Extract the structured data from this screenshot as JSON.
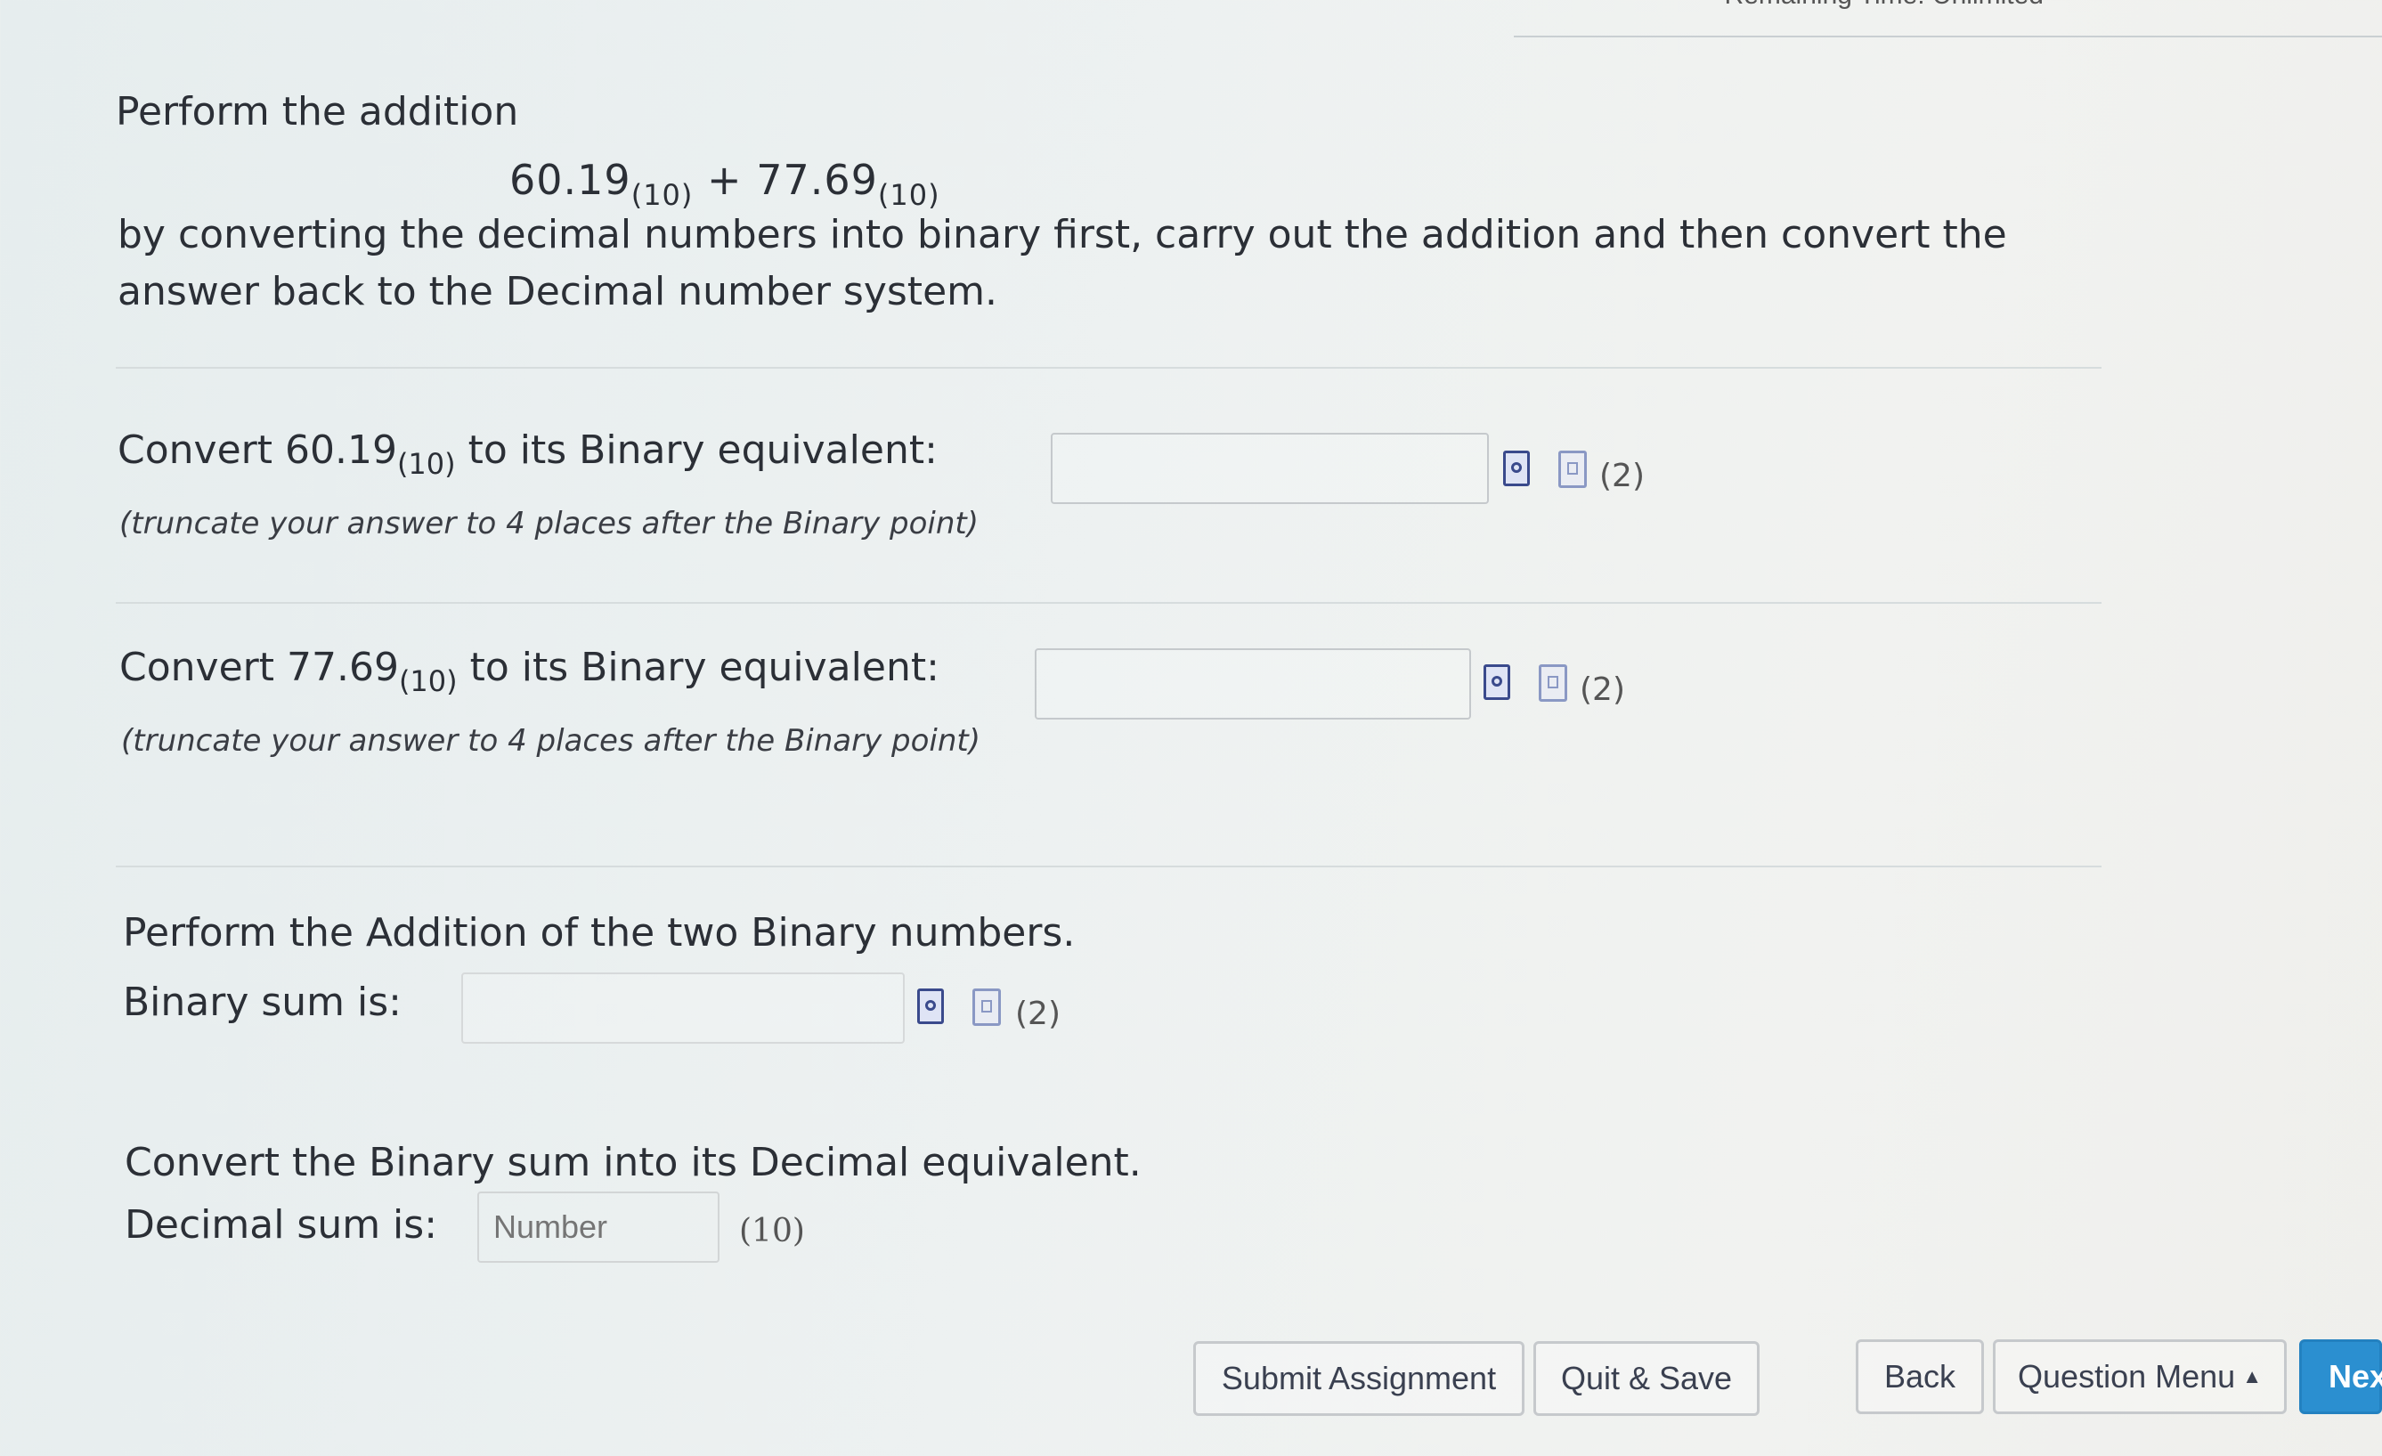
{
  "header": {
    "timer_text": "Remaining Time: Unlimited"
  },
  "problem": {
    "title": "Perform the addition",
    "expr_a": "60.19",
    "expr_a_base": "(10)",
    "expr_op": " + ",
    "expr_b": "77.69",
    "expr_b_base": "(10)",
    "description": "by converting the decimal numbers into binary first, carry out the addition and then convert the answer back to the Decimal number system."
  },
  "q1": {
    "prefix": "Convert ",
    "number": "60.19",
    "base": "(10)",
    "suffix": " to its Binary equivalent:",
    "note": "(truncate your answer to 4 places after the Binary point)",
    "attempts": "(2)"
  },
  "q2": {
    "prefix": "Convert ",
    "number": "77.69",
    "base": "(10)",
    "suffix": " to its Binary equivalent:",
    "note": "(truncate your answer to 4 places after the Binary point)",
    "attempts": "(2)"
  },
  "q3": {
    "heading": "Perform the Addition of the two Binary numbers.",
    "label": "Binary sum is:",
    "attempts": "(2)"
  },
  "q4": {
    "heading": "Convert the Binary sum into its Decimal equivalent.",
    "label": "Decimal sum is:",
    "placeholder": "Number",
    "base": "(10)"
  },
  "footer": {
    "submit": "Submit Assignment",
    "quit_save": "Quit & Save",
    "back": "Back",
    "question_menu": "Question Menu",
    "next": "Nex"
  }
}
